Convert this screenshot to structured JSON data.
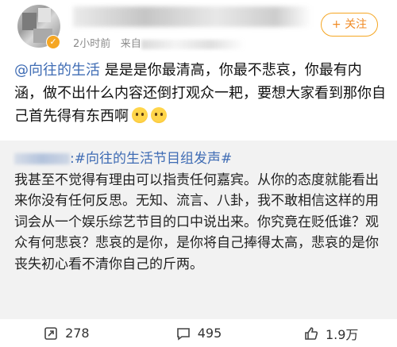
{
  "header": {
    "meta_time": "2小时前",
    "meta_source_prefix": "来自",
    "follow_label": "+ 关注"
  },
  "post": {
    "mention": "@向往的生活",
    "text": " 是是是你最清高，你最不悲哀，你最有内涵，做不出什么内容还倒打观众一耙，要想大家看到那你自己首先得有东西啊"
  },
  "repost": {
    "user_suffix": ":",
    "hashtag": "#向往的生活节目组发声#",
    "text": "我甚至不觉得有理由可以指责任何嘉宾。从你的态度就能看出来你没有任何反思。无知、流言、八卦，我不敢相信这样的用词会从一个娱乐综艺节目的口中说出来。你究竟在贬低谁？观众有何悲哀？悲哀的是你，是你将自己捧得太高，悲哀的是你丧失初心看不清你自己的斤两。"
  },
  "actions": {
    "repost_count": "278",
    "comment_count": "495",
    "like_count": "1.9万"
  },
  "colors": {
    "accent": "#f08a24",
    "mention": "#3f6cb4",
    "quote_bg": "#f2f2f2"
  }
}
